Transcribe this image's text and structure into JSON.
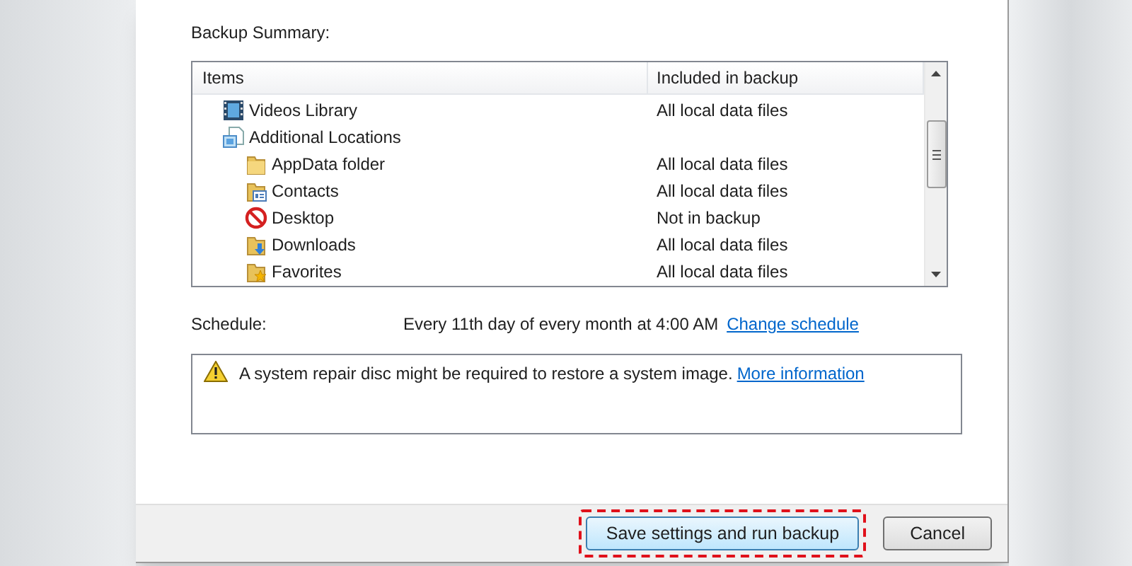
{
  "summary_label": "Backup Summary:",
  "table": {
    "columns": [
      "Items",
      "Included in backup"
    ],
    "rows": [
      {
        "name": "Videos Library",
        "kind": "video",
        "included": "All local data files"
      },
      {
        "name": "Additional Locations",
        "kind": "locations",
        "children": [
          {
            "name": "AppData folder",
            "kind": "folder",
            "included": "All local data files"
          },
          {
            "name": "Contacts",
            "kind": "contacts",
            "included": "All local data files"
          },
          {
            "name": "Desktop",
            "kind": "blocked",
            "included": "Not in backup"
          },
          {
            "name": "Downloads",
            "kind": "downloads",
            "included": "All local data files"
          },
          {
            "name": "Favorites",
            "kind": "favorites",
            "included": "All local data files"
          }
        ]
      }
    ]
  },
  "schedule": {
    "label": "Schedule:",
    "value": "Every 11th day of every month at 4:00 AM",
    "link": "Change schedule"
  },
  "warning": {
    "text": "A system repair disc might be required to restore a system image.",
    "link": "More information"
  },
  "buttons": [
    {
      "label": "Save settings and run backup",
      "highlighted": true,
      "default": true
    },
    {
      "label": "Cancel",
      "highlighted": false,
      "default": false
    }
  ]
}
